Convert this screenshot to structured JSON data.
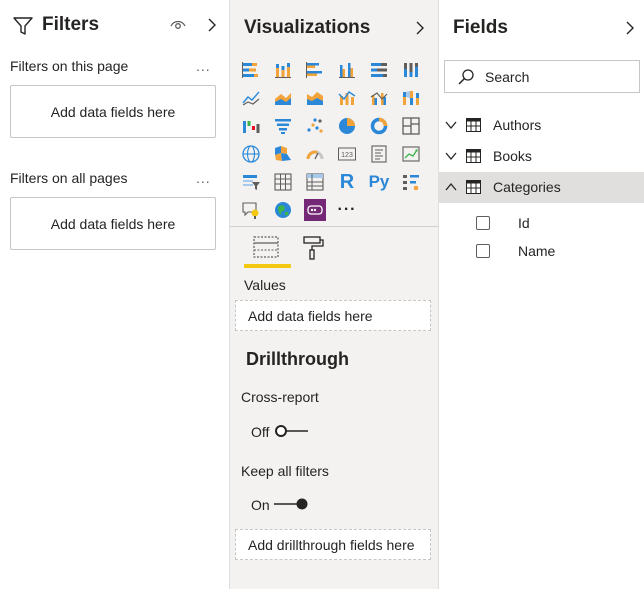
{
  "filters": {
    "title": "Filters",
    "icons": [
      "funnel-icon",
      "eye-icon",
      "chevron-right-icon"
    ],
    "sections": [
      {
        "label": "Filters on this page",
        "more": "...",
        "dropzone": "Add data fields here"
      },
      {
        "label": "Filters on all pages",
        "more": "...",
        "dropzone": "Add data fields here"
      }
    ]
  },
  "visualizations": {
    "title": "Visualizations",
    "visual_icons": [
      "stacked-bar-chart-icon",
      "stacked-column-chart-icon",
      "clustered-bar-chart-icon",
      "clustered-column-chart-icon",
      "100-percent-stacked-bar-chart-icon",
      "100-percent-stacked-column-chart-icon",
      "line-chart-icon",
      "area-chart-icon",
      "stacked-area-chart-icon",
      "line-and-stacked-column-chart-icon",
      "line-and-clustered-column-chart-icon",
      "ribbon-chart-icon",
      "waterfall-chart-icon",
      "funnel-chart-icon",
      "scatter-chart-icon",
      "pie-chart-icon",
      "donut-chart-icon",
      "treemap-icon",
      "map-icon",
      "filled-map-icon",
      "gauge-icon",
      "card-icon",
      "multi-row-card-icon",
      "kpi-icon",
      "slicer-icon",
      "table-icon",
      "matrix-icon",
      "r-script-visual-icon",
      "python-visual-icon",
      "key-influencers-icon",
      "qna-icon",
      "arcgis-map-icon",
      "power-apps-icon",
      "more-visuals-icon"
    ],
    "more_label": "···",
    "tabs": [
      "fields-tab-icon",
      "format-paint-roller-icon"
    ],
    "values_label": "Values",
    "values_dropzone": "Add data fields here",
    "drillthrough": {
      "title": "Drillthrough",
      "cross_report_label": "Cross-report",
      "cross_report_state": "Off",
      "keep_filters_label": "Keep all filters",
      "keep_filters_state": "On",
      "dropzone": "Add drillthrough fields here"
    }
  },
  "fields": {
    "title": "Fields",
    "search_placeholder": "Search",
    "tables": [
      {
        "name": "Authors",
        "expanded": false
      },
      {
        "name": "Books",
        "expanded": false
      },
      {
        "name": "Categories",
        "expanded": true,
        "selected": true,
        "columns": [
          "Id",
          "Name"
        ]
      }
    ]
  },
  "colors": {
    "accent": "#f2c811",
    "power_bi_blue": "#2b88d8",
    "power_apps_purple": "#742774",
    "pane_background": "#f3f2f1",
    "selected_row": "#e1dfdd"
  }
}
